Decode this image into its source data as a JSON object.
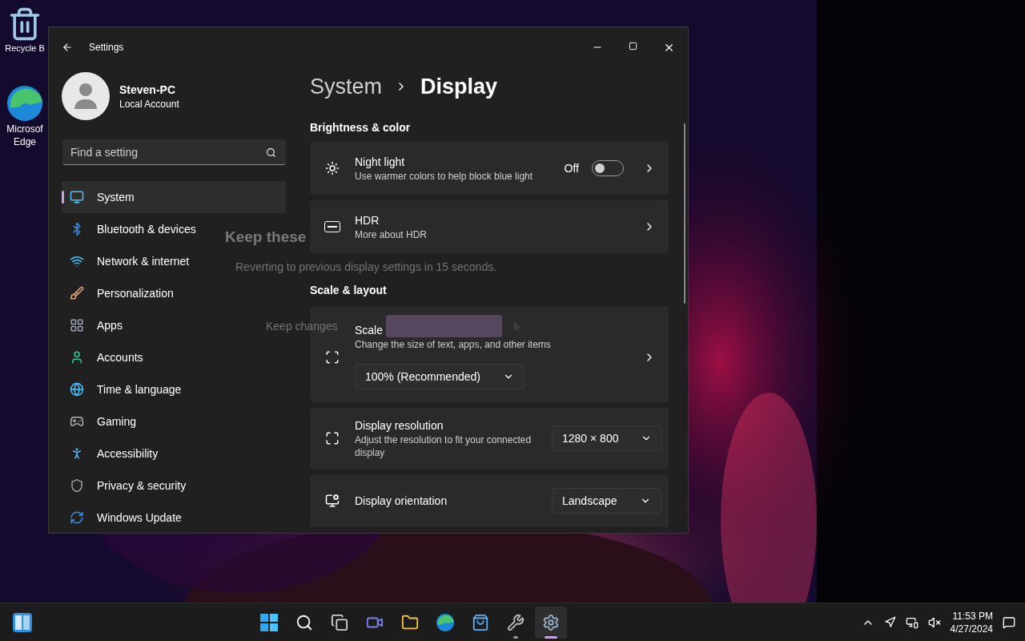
{
  "desktop_icons": [
    {
      "label": "Recycle B"
    },
    {
      "label": "Microsof Edge"
    }
  ],
  "window": {
    "title": "Settings",
    "account": {
      "name": "Steven-PC",
      "type": "Local Account"
    },
    "search": {
      "placeholder": "Find a setting"
    },
    "nav": [
      {
        "label": "System",
        "selected": true
      },
      {
        "label": "Bluetooth & devices",
        "selected": false
      },
      {
        "label": "Network & internet",
        "selected": false
      },
      {
        "label": "Personalization",
        "selected": false
      },
      {
        "label": "Apps",
        "selected": false
      },
      {
        "label": "Accounts",
        "selected": false
      },
      {
        "label": "Time & language",
        "selected": false
      },
      {
        "label": "Gaming",
        "selected": false
      },
      {
        "label": "Accessibility",
        "selected": false
      },
      {
        "label": "Privacy & security",
        "selected": false
      },
      {
        "label": "Windows Update",
        "selected": false
      }
    ],
    "breadcrumb": {
      "parent": "System",
      "current": "Display"
    },
    "sections": [
      {
        "title": "Brightness & color",
        "cards": [
          {
            "kind": "toggle",
            "title": "Night light",
            "description": "Use warmer colors to help block blue light",
            "status": "Off",
            "on": false
          },
          {
            "kind": "link",
            "title": "HDR",
            "description": "More about HDR"
          }
        ]
      },
      {
        "title": "Scale & layout",
        "cards": [
          {
            "kind": "dropdown_below",
            "title": "Scale",
            "description": "Change the size of text, apps, and other items",
            "value": "100% (Recommended)"
          },
          {
            "kind": "dropdown",
            "title": "Display resolution",
            "description": "Adjust the resolution to fit your connected display",
            "value": "1280 × 800"
          },
          {
            "kind": "dropdown",
            "title": "Display orientation",
            "value": "Landscape"
          }
        ]
      }
    ]
  },
  "dialog": {
    "title": "Keep these",
    "message": "Reverting to previous display settings in 15 seconds.",
    "buttons": [
      {
        "kind": "secondary",
        "label": "Keep changes"
      },
      {
        "kind": "primary"
      }
    ]
  },
  "taskbar": {
    "apps": [
      {
        "active": false,
        "running": false
      },
      {
        "active": false,
        "running": false
      },
      {
        "active": false,
        "running": false
      },
      {
        "active": false,
        "running": false
      },
      {
        "active": false,
        "running": false
      },
      {
        "active": false,
        "running": false
      },
      {
        "active": false,
        "running": false
      },
      {
        "active": false,
        "running": true
      },
      {
        "active": true,
        "running": true
      }
    ],
    "clock": {
      "time": "11:53 PM",
      "date": "4/27/2024"
    }
  }
}
